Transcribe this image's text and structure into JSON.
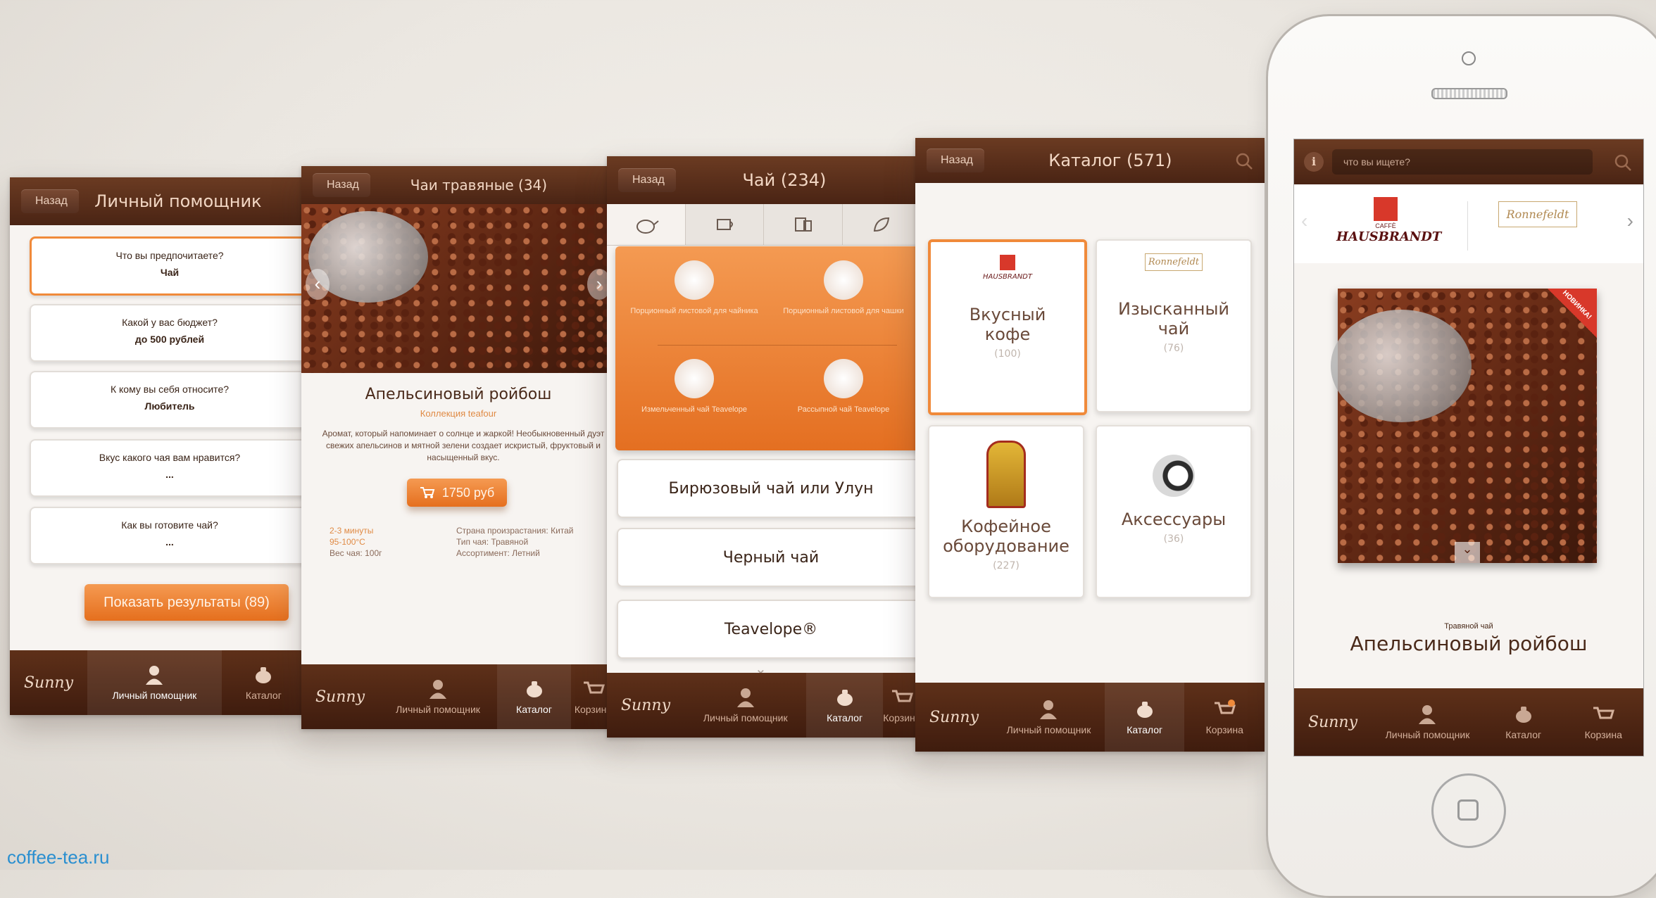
{
  "screen1": {
    "back": "Назад",
    "title": "Личный помощник",
    "questions": [
      {
        "q": "Что вы предпочитаете?",
        "a": "Чай"
      },
      {
        "q": "Какой у вас бюджет?",
        "a": "до 500 рублей"
      },
      {
        "q": "К кому вы себя относите?",
        "a": "Любитель"
      },
      {
        "q": "Вкус какого чая вам нравится?",
        "a": "..."
      },
      {
        "q": "Как вы готовите чай?",
        "a": "..."
      }
    ],
    "show_results": "Показать результаты (89)",
    "nav": [
      "Личный помощник",
      "Каталог"
    ]
  },
  "screen2": {
    "back": "Назад",
    "title": "Чаи травяные (34)",
    "product": "Апельсиновый ройбош",
    "collection": "Коллекция teafour",
    "description": "Аромат, который напоминает о солнце и жаркой! Необыкновенный дуэт свежих апельсинов и мятной зелени создает искристый, фруктовый и насыщенный вкус.",
    "price": "1750 руб",
    "info_left": [
      "2-3 минуты",
      "95-100°С",
      "Вес чая: 100г"
    ],
    "info_right": [
      "Страна произрастания: Китай",
      "Тип чая: Травяной",
      "Ассортимент: Летний"
    ],
    "nav": [
      "Личный помощник",
      "Каталог",
      "Корзина"
    ]
  },
  "screen3": {
    "back": "Назад",
    "title": "Чай (234)",
    "grid": [
      "Порционный листовой для чайника",
      "Порционный листовой для чашки",
      "Измельченный чай Teavelope",
      "Рассыпной чай Teavelope"
    ],
    "items": [
      "Бирюзовый чай или Улун",
      "Черный чай",
      "Teavelope®"
    ],
    "nav": [
      "Личный помощник",
      "Каталог",
      "Корзина"
    ]
  },
  "screen4": {
    "back": "Назад",
    "title": "Каталог (571)",
    "tiles": [
      {
        "brand": "HAUSBRANDT",
        "label": "Вкусный кофе",
        "count": "(100)"
      },
      {
        "brand": "Ronnefeldt",
        "label": "Изысканный чай",
        "count": "(76)"
      },
      {
        "brand": "",
        "label": "Кофейное оборудование",
        "count": "(227)"
      },
      {
        "brand": "",
        "label": "Аксессуары",
        "count": "(36)"
      }
    ],
    "nav": [
      "Личный помощник",
      "Каталог",
      "Корзина"
    ]
  },
  "phone": {
    "search_placeholder": "что вы ищете?",
    "brand1": "HAUSBRANDT",
    "brand1_small": "CAFFÈ",
    "brand2": "Ronnefeldt",
    "badge": "НОВИНКА!",
    "subtitle": "Травяной чай",
    "product": "Апельсиновый ройбош",
    "nav": [
      "Личный помощник",
      "Каталог",
      "Корзина"
    ]
  },
  "logo": "Sunny",
  "caption": "coffee-tea.ru",
  "colors": {
    "brown": "#4a2414",
    "orange": "#f08a3a",
    "bg": "#ebe7e1",
    "link": "#2a8fd0"
  }
}
